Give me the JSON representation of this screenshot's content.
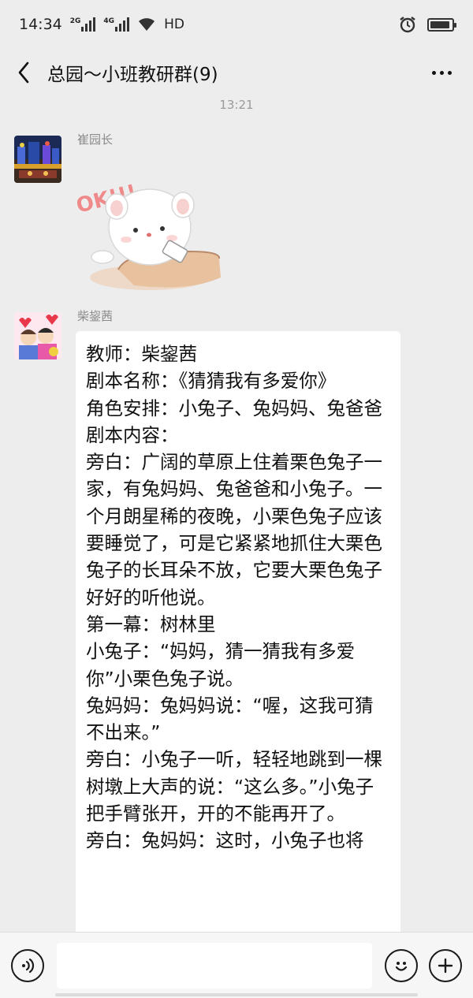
{
  "status_bar": {
    "time": "14:34",
    "network1": "2G",
    "network2": "4G",
    "hd": "HD"
  },
  "header": {
    "title": "总园～小班教研群(9)"
  },
  "timestamp": "13:21",
  "messages": [
    {
      "sender": "崔园长",
      "sticker_text": "OK!!!"
    },
    {
      "sender": "柴鋆茜",
      "lines": [
        "教师：柴鋆茜",
        "剧本名称：《猜猜我有多爱你》",
        "角色安排：小兔子、兔妈妈、兔爸爸",
        "剧本内容：",
        "旁白：广阔的草原上住着栗色兔子一家，有兔妈妈、兔爸爸和小兔子。一个月朗星稀的夜晚，小栗色兔子应该要睡觉了，可是它紧紧地抓住大栗色兔子的长耳朵不放，它要大栗色兔子好好的听他说。",
        "第一幕：树林里",
        "小兔子：“妈妈，猜一猜我有多爱你”小栗色兔子说。",
        "兔妈妈：兔妈妈说：“喔，这我可猜不出来。”",
        "旁白：小兔子一听，轻轻地跳到一棵树墩上大声的说：“这么多。”小兔子把手臂张开，开的不能再开了。",
        "旁白：兔妈妈：这时，小兔子也将"
      ]
    }
  ],
  "input_bar": {
    "placeholder": ""
  }
}
